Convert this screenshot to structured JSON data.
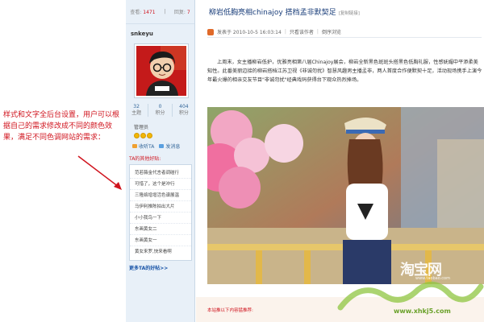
{
  "annotation": {
    "text": "样式和文字全后台设置，用户可以根据自己的需求修改成不同的颜色效果，满足不同色调网站的需求："
  },
  "sidebar": {
    "views_label": "查看:",
    "views_value": "1471",
    "replies_label": "回复:",
    "replies_value": "7",
    "username": "snkeyu",
    "stats": [
      {
        "value": "32",
        "label": "主题"
      },
      {
        "value": "0",
        "label": "积分"
      },
      {
        "value": "404",
        "label": "积分"
      }
    ],
    "group": "管理员",
    "actions": {
      "add_friend": "收听TA",
      "message": "发消息"
    },
    "friends_title": "TA的其他好贴:",
    "friends": [
      "范若薇金代言者调碰行",
      "可惜了，这个是冲行",
      "三隆络增增活色谱展温",
      "马伊利推陈拍出大片",
      "小小我鸟一下",
      "东画黄女二",
      "东画黄女一",
      "黄女来罗,快来看啊"
    ],
    "friends_more": "更多TA的好帖>>"
  },
  "post": {
    "title": "柳岩低胸亮相chinajoy 搭档孟非默契足",
    "title_tag": "[复制链接]",
    "meta_posted": "发表于 2010-10-5 16:03:14",
    "meta_author_only": "只看该作者",
    "meta_reverse": "倒序浏览",
    "body": "上周末，女主播柳岩低护，优雅亮相第八届Chinajoy展会，柳岩全新黑色斑斑头搭黑色低胸礼服，性感妩媚中平添柔美知性。此番美丽边接的柳岩搭档江苏卫视《非诚勿扰》智慧风趣男主播孟非，两人首度合作便默契十足，活动现场携手上演今年最火爆的相亲交友节目\"非诚勿扰\"经典戏码获得台下观众热烈捧场。",
    "recommend": "本站推以下内容猛推荐:"
  },
  "watermark": {
    "taobao": "淘宝网",
    "taobao_url": "www.taobao.com",
    "site": "www.xhkj5.com"
  }
}
